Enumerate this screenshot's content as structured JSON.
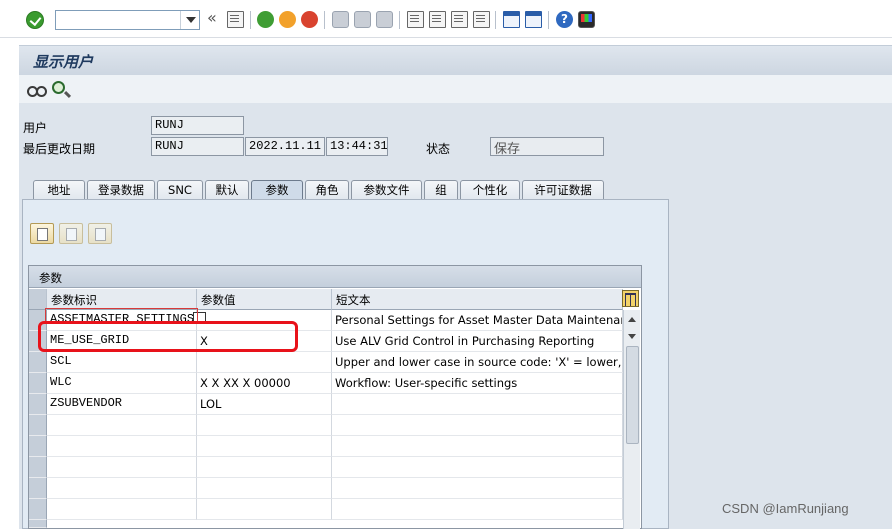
{
  "toolbar": {
    "command_field_value": "",
    "icons": [
      "enter-icon",
      "back-icon",
      "save-icon",
      "back-nav-icon",
      "exit-icon",
      "cancel-icon",
      "print-icon",
      "find-icon",
      "find-next-icon",
      "first-page-icon",
      "prev-page-icon",
      "next-page-icon",
      "last-page-icon",
      "new-session-icon",
      "shortcut-icon",
      "help-icon",
      "customize-layout-icon"
    ]
  },
  "title": "显示用户",
  "app_toolbar": {
    "icons": [
      "display-change-icon",
      "zoom-icon"
    ]
  },
  "header": {
    "user_label": "用户",
    "user_value": "RUNJ",
    "last_changed_label": "最后更改日期",
    "last_changed_by": "RUNJ",
    "last_changed_date": "2022.11.11",
    "last_changed_time": "13:44:31",
    "status_label": "状态",
    "status_value": "保存"
  },
  "tabs": [
    {
      "label": "地址",
      "active": false
    },
    {
      "label": "登录数据",
      "active": false
    },
    {
      "label": "SNC",
      "active": false
    },
    {
      "label": "默认",
      "active": false
    },
    {
      "label": "参数",
      "active": true
    },
    {
      "label": "角色",
      "active": false
    },
    {
      "label": "参数文件",
      "active": false
    },
    {
      "label": "组",
      "active": false
    },
    {
      "label": "个性化",
      "active": false
    },
    {
      "label": "许可证数据",
      "active": false
    }
  ],
  "parameters": {
    "section_title": "参数",
    "columns": [
      "参数标识",
      "参数值",
      "短文本"
    ],
    "rows": [
      {
        "id": "ASSETMASTER_SETTINGS",
        "value": "",
        "text": "Personal Settings for Asset Master Data Maintenance"
      },
      {
        "id": "ME_USE_GRID",
        "value": "X",
        "text": "Use ALV Grid Control in Purchasing Reporting"
      },
      {
        "id": "SCL",
        "value": "",
        "text": "Upper and lower case in source code: 'X' = lower, ' ' =upper"
      },
      {
        "id": "WLC",
        "value": "X  X XX  X 00000",
        "text": "Workflow: User-specific settings"
      },
      {
        "id": "ZSUBVENDOR",
        "value": "LOL",
        "text": ""
      }
    ]
  },
  "watermark": "CSDN @IamRunjiang",
  "colors": {
    "highlight": "#e8121a",
    "title_text": "#1f3a5f",
    "panel_bg": "#e2ebf4"
  }
}
